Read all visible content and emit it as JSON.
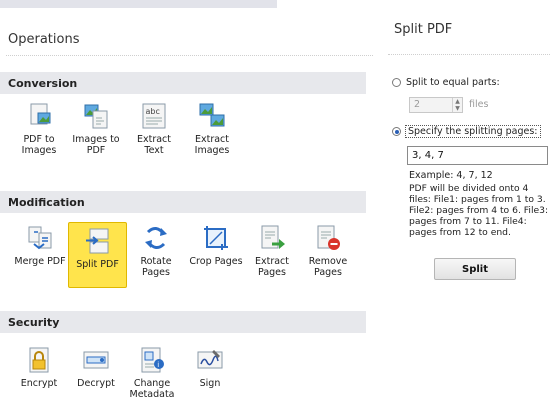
{
  "operations": {
    "title": "Operations",
    "sections": [
      {
        "label": "Conversion",
        "items": [
          {
            "label": "PDF to\nImages",
            "icon": "pdf-to-images-icon"
          },
          {
            "label": "Images to\nPDF",
            "icon": "images-to-pdf-icon"
          },
          {
            "label": "Extract\nText",
            "icon": "extract-text-icon"
          },
          {
            "label": "Extract\nImages",
            "icon": "extract-images-icon"
          }
        ]
      },
      {
        "label": "Modification",
        "items": [
          {
            "label": "Merge PDF",
            "icon": "merge-pdf-icon"
          },
          {
            "label": "Split PDF",
            "icon": "split-pdf-icon",
            "active": true
          },
          {
            "label": "Rotate\nPages",
            "icon": "rotate-pages-icon"
          },
          {
            "label": "Crop Pages",
            "icon": "crop-pages-icon"
          },
          {
            "label": "Extract\nPages",
            "icon": "extract-pages-icon"
          },
          {
            "label": "Remove\nPages",
            "icon": "remove-pages-icon"
          }
        ]
      },
      {
        "label": "Security",
        "items": [
          {
            "label": "Encrypt",
            "icon": "encrypt-icon"
          },
          {
            "label": "Decrypt",
            "icon": "decrypt-icon"
          },
          {
            "label": "Change\nMetadata",
            "icon": "change-metadata-icon"
          },
          {
            "label": "Sign",
            "icon": "sign-icon"
          }
        ]
      }
    ]
  },
  "split_panel": {
    "title": "Split PDF",
    "option_equal_label": "Split to equal parts:",
    "parts_value": "2",
    "parts_unit": "files",
    "option_pages_label": "Specify the splitting pages:",
    "selected_option": "pages",
    "pages_value": "3, 4, 7",
    "example": "Example: 4, 7, 12",
    "description": "PDF will be divided onto 4 files: File1: pages from 1 to 3. File2: pages from 4 to 6. File3: pages from 7 to 11. File4: pages from 12 to end.",
    "button_label": "Split"
  },
  "colors": {
    "section_header_bg": "#e7e8ec",
    "active_tile_bg": "#ffe44c",
    "accent_blue": "#2b6cc4"
  }
}
